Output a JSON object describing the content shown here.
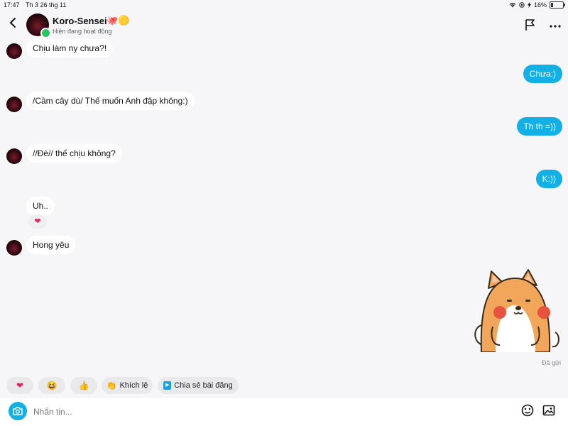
{
  "status_bar": {
    "time": "17:47",
    "date": "Th 3 26 thg 11",
    "battery": "16%"
  },
  "header": {
    "name": "Koro-Sensei",
    "name_emoji": "🐙🟡",
    "status": "Hiện đang hoạt động"
  },
  "messages": [
    {
      "dir": "in",
      "text": "Chịu làm ny chưa?!"
    },
    {
      "dir": "out",
      "text": "Chưa:)"
    },
    {
      "dir": "in",
      "text": "/Cầm cây dù/ Thế muốn Anh đập không:)"
    },
    {
      "dir": "out",
      "text": "Th th =))"
    },
    {
      "dir": "in",
      "text": "//Đè// thế chịu không?"
    },
    {
      "dir": "out",
      "text": "K:))"
    },
    {
      "dir": "in",
      "text": "Uh..",
      "reaction": "❤"
    },
    {
      "dir": "in",
      "text": "Hong yêu"
    }
  ],
  "sent_status": "Đã gửi",
  "quick_replies": [
    {
      "icon": "heart-icon",
      "label": "",
      "glyph": "❤"
    },
    {
      "icon": "laugh-icon",
      "label": "",
      "glyph": "😆"
    },
    {
      "icon": "thumbs-up-icon",
      "label": "",
      "glyph": "👍"
    },
    {
      "icon": "clap-icon",
      "label": "Khích lệ",
      "glyph": "👏"
    },
    {
      "icon": "share-post-icon",
      "label": "Chia sẻ bài đăng",
      "glyph": "▶"
    }
  ],
  "input": {
    "placeholder": "Nhắn tin..."
  },
  "colors": {
    "accent": "#13b0e6",
    "online": "#22c55e",
    "incoming": "#ffffff",
    "background": "#f6f6f8"
  }
}
